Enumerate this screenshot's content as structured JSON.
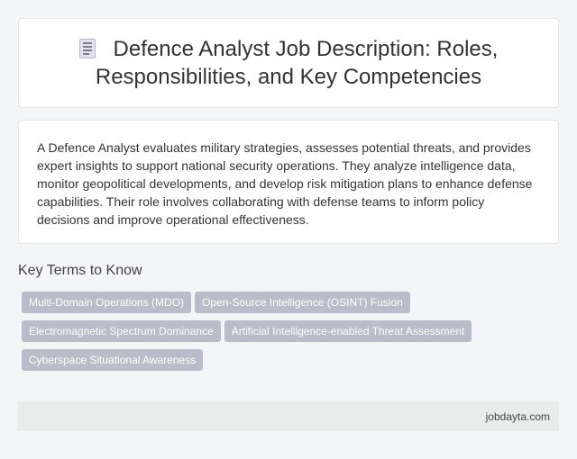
{
  "header": {
    "icon": "document-icon",
    "title": "Defence Analyst Job Description: Roles, Responsibilities, and Key Competencies"
  },
  "summary": {
    "text": "A Defence Analyst evaluates military strategies, assesses potential threats, and provides expert insights to support national security operations. They analyze intelligence data, monitor geopolitical developments, and develop risk mitigation plans to enhance defense capabilities. Their role involves collaborating with defense teams to inform policy decisions and improve operational effectiveness."
  },
  "key_terms": {
    "heading": "Key Terms to Know",
    "tags": [
      "Multi-Domain Operations (MDO)",
      "Open-Source Intelligence (OSINT) Fusion",
      "Electromagnetic Spectrum Dominance",
      "Artificial Intelligence-enabled Threat Assessment",
      "Cyberspace Situational Awareness"
    ]
  },
  "footer": {
    "site": "jobdayta.com"
  }
}
